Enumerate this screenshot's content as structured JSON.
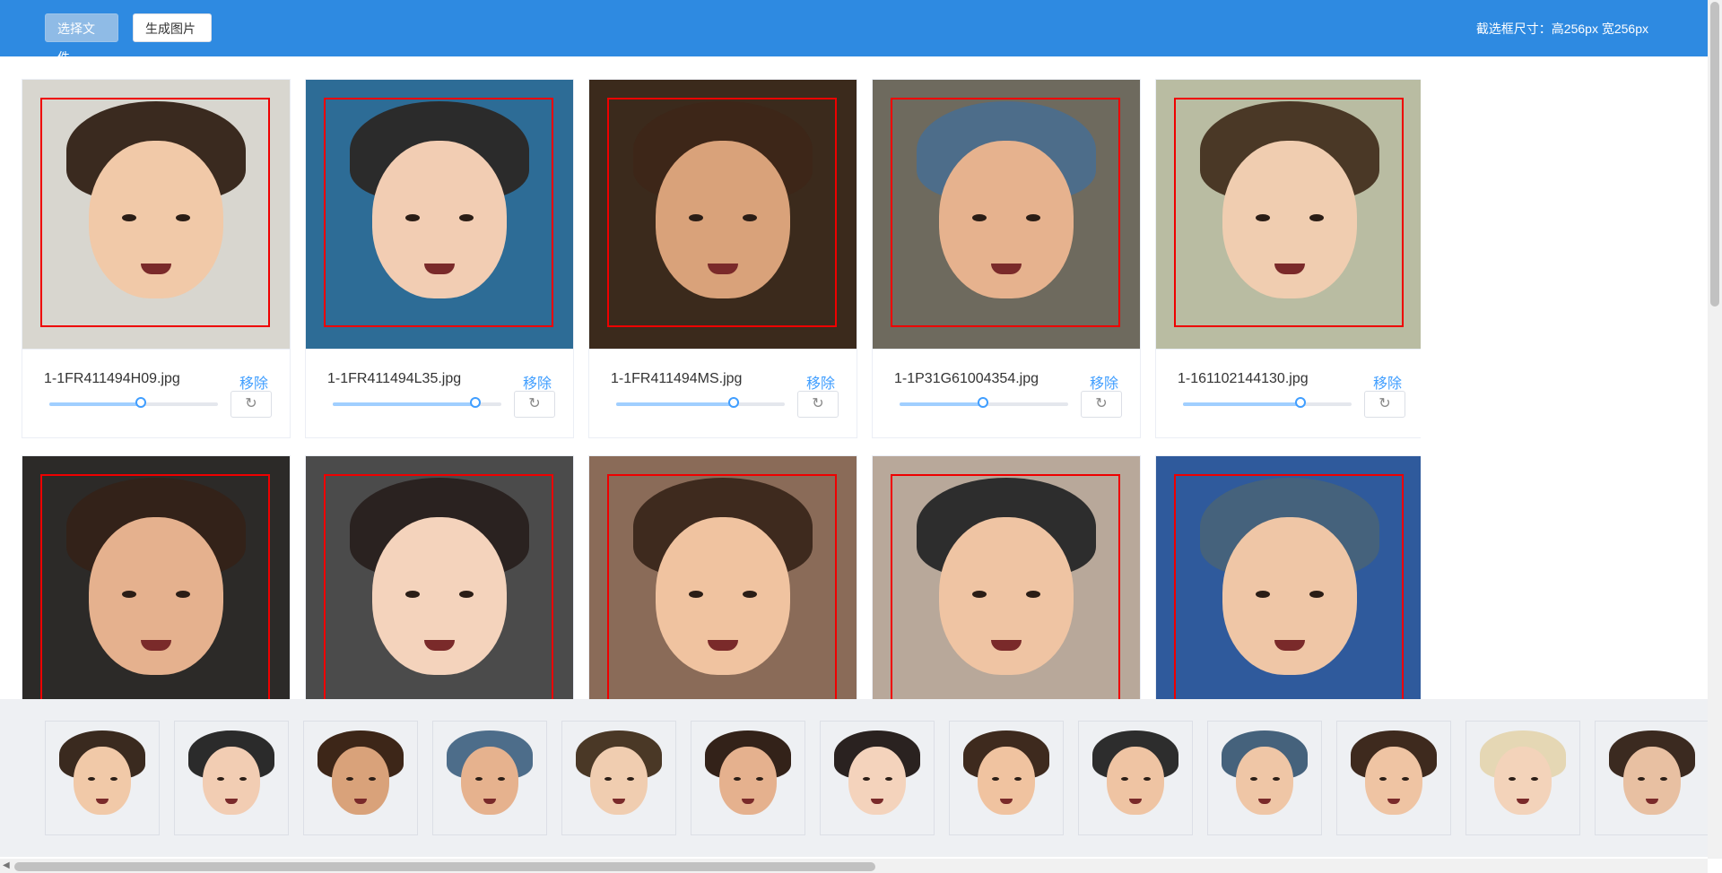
{
  "toolbar": {
    "select_file_label": "选择文件",
    "generate_label": "生成图片",
    "crop_size_text": "截选框尺寸：高256px 宽256px"
  },
  "cards": [
    {
      "filename": "1-1FR411494H09.jpg",
      "remove_label": "移除",
      "zoom": 0.55,
      "bg": "#d8d6cf",
      "skin": "#f1c9a8",
      "hair": "#3a2a1f"
    },
    {
      "filename": "1-1FR411494L35.jpg",
      "remove_label": "移除",
      "zoom": 0.85,
      "bg": "#2d6c96",
      "skin": "#f2cdb3",
      "hair": "#2b2b2b"
    },
    {
      "filename": "1-1FR411494MS.jpg",
      "remove_label": "移除",
      "zoom": 0.7,
      "bg": "#3b2a1c",
      "skin": "#d9a27a",
      "hair": "#3d2618"
    },
    {
      "filename": "1-1P31G61004354.jpg",
      "remove_label": "移除",
      "zoom": 0.5,
      "bg": "#6e6a5e",
      "skin": "#e6b28e",
      "hair": "#4d6d8a"
    },
    {
      "filename": "1-161102144130.jpg",
      "remove_label": "移除",
      "zoom": 0.7,
      "bg": "#b9bca2",
      "skin": "#f0cdb0",
      "hair": "#4a3826"
    },
    {
      "filename": "",
      "remove_label": "",
      "zoom": 0,
      "bg": "#2c2a28",
      "skin": "#e5b18e",
      "hair": "#332219"
    },
    {
      "filename": "",
      "remove_label": "",
      "zoom": 0,
      "bg": "#4b4b4b",
      "skin": "#f4d3bc",
      "hair": "#2a2220"
    },
    {
      "filename": "",
      "remove_label": "",
      "zoom": 0,
      "bg": "#8a6b58",
      "skin": "#f0c3a0",
      "hair": "#3e2a1e"
    },
    {
      "filename": "",
      "remove_label": "",
      "zoom": 0,
      "bg": "#b8a89a",
      "skin": "#efc4a3",
      "hair": "#2d2d2d"
    },
    {
      "filename": "",
      "remove_label": "",
      "zoom": 0,
      "bg": "#2f5a9c",
      "skin": "#efc6a6",
      "hair": "#45627c"
    }
  ],
  "thumbnails": [
    {
      "bg": "#d8d6cf",
      "skin": "#f1c9a8",
      "hair": "#3a2a1f"
    },
    {
      "bg": "#2d6c96",
      "skin": "#f2cdb3",
      "hair": "#2b2b2b"
    },
    {
      "bg": "#7a2a1c",
      "skin": "#d9a27a",
      "hair": "#3d2618"
    },
    {
      "bg": "#6e6a5e",
      "skin": "#e6b28e",
      "hair": "#4d6d8a"
    },
    {
      "bg": "#b9bca2",
      "skin": "#f0cdb0",
      "hair": "#4a3826"
    },
    {
      "bg": "#2c2a28",
      "skin": "#e5b18e",
      "hair": "#332219"
    },
    {
      "bg": "#4b4b4b",
      "skin": "#f4d3bc",
      "hair": "#2a2220"
    },
    {
      "bg": "#8a6b58",
      "skin": "#f0c3a0",
      "hair": "#3e2a1e"
    },
    {
      "bg": "#b8a89a",
      "skin": "#efc4a3",
      "hair": "#2d2d2d"
    },
    {
      "bg": "#2f5a9c",
      "skin": "#efc6a6",
      "hair": "#45627c"
    },
    {
      "bg": "#c4c2aa",
      "skin": "#efc4a3",
      "hair": "#3e2a1e"
    },
    {
      "bg": "#f0e4c8",
      "skin": "#f3d3ba",
      "hair": "#e5d7b4"
    },
    {
      "bg": "#7c7c7c",
      "skin": "#e8c0a2",
      "hair": "#3b2a20"
    }
  ]
}
